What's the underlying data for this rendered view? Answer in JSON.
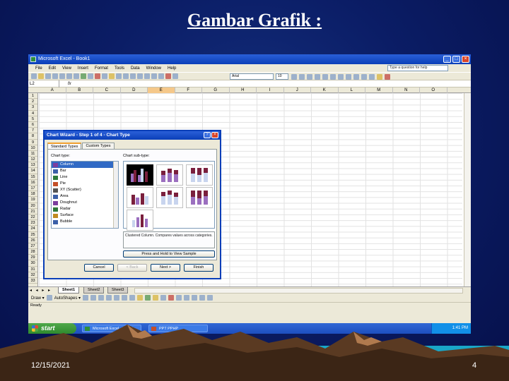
{
  "slide": {
    "title": "Gambar  Grafik :",
    "date": "12/15/2021",
    "page_number": "4"
  },
  "window": {
    "title": "Microsoft Excel - Book1",
    "controls": [
      "_",
      "□",
      "×"
    ]
  },
  "menubar": {
    "items": [
      "File",
      "Edit",
      "View",
      "Insert",
      "Format",
      "Tools",
      "Data",
      "Window",
      "Help"
    ],
    "help_placeholder": "Type a question for help"
  },
  "toolbar": {
    "font": "Arial",
    "font_size": "10"
  },
  "formula_bar": {
    "name_box": "L2",
    "fx": "fx"
  },
  "grid": {
    "columns": [
      "A",
      "B",
      "C",
      "D",
      "E",
      "F",
      "G",
      "H",
      "I",
      "J",
      "K",
      "L",
      "M",
      "N",
      "O"
    ],
    "active_column": "E",
    "rows": [
      "1",
      "2",
      "3",
      "4",
      "5",
      "6",
      "7",
      "8",
      "9",
      "10",
      "11",
      "12",
      "13",
      "14",
      "15",
      "16",
      "17",
      "18",
      "19",
      "20",
      "21",
      "22",
      "23",
      "24",
      "25",
      "26",
      "27",
      "28",
      "29",
      "30",
      "31",
      "32",
      "33"
    ]
  },
  "sheet_tabs": {
    "nav": "◂ ◂ ▸ ▸",
    "tabs": [
      "Sheet1",
      "Sheet2",
      "Sheet3"
    ],
    "active": "Sheet1"
  },
  "draw_toolbar": {
    "draw_label": "Draw ▾",
    "autoshapes_label": "AutoShapes ▾"
  },
  "status_bar": {
    "text": "Ready"
  },
  "taskbar": {
    "start": "start",
    "items": [
      "Microsoft Excel - Book1",
      "PPT PPHP"
    ],
    "clock": "1:41 PM"
  },
  "chart_wizard": {
    "title": "Chart Wizard - Step 1 of 4 - Chart Type",
    "help": "?",
    "close": "×",
    "tabs": [
      "Standard Types",
      "Custom Types"
    ],
    "chart_type_label": "Chart type:",
    "subtype_label": "Chart sub-type:",
    "chart_types": [
      {
        "label": "Column",
        "icon": "column-chart-icon",
        "color": "#7b3f9e"
      },
      {
        "label": "Bar",
        "icon": "bar-chart-icon",
        "color": "#3b5fa8"
      },
      {
        "label": "Line",
        "icon": "line-chart-icon",
        "color": "#2d7a3a"
      },
      {
        "label": "Pie",
        "icon": "pie-chart-icon",
        "color": "#c4502a"
      },
      {
        "label": "XY (Scatter)",
        "icon": "scatter-chart-icon",
        "color": "#555555"
      },
      {
        "label": "Area",
        "icon": "area-chart-icon",
        "color": "#3b5fa8"
      },
      {
        "label": "Doughnut",
        "icon": "doughnut-chart-icon",
        "color": "#7b3f9e"
      },
      {
        "label": "Radar",
        "icon": "radar-chart-icon",
        "color": "#2d7a3a"
      },
      {
        "label": "Surface",
        "icon": "surface-chart-icon",
        "color": "#c08a20"
      },
      {
        "label": "Bubble",
        "icon": "bubble-chart-icon",
        "color": "#3b5fa8"
      }
    ],
    "selected_type": "Column",
    "description": "Clustered Column. Compares values across categories.",
    "press_button": "Press and Hold to View Sample",
    "buttons": [
      "Cancel",
      "< Back",
      "Next >",
      "Finish"
    ],
    "colors": {
      "series1": "#9b6fbf",
      "series2": "#7a1f3d",
      "series3": "#c8d4ee"
    }
  }
}
